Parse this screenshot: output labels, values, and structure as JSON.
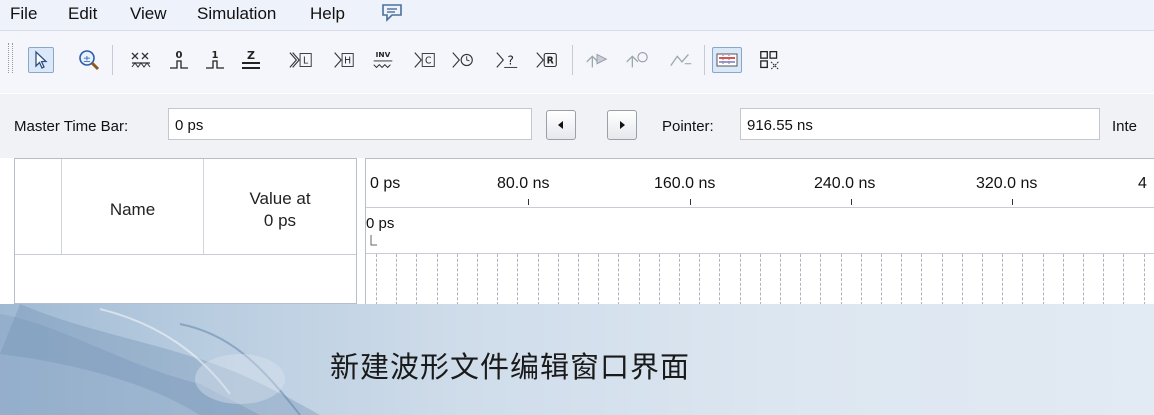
{
  "menu": {
    "file": "File",
    "edit": "Edit",
    "view": "View",
    "simulation": "Simulation",
    "help": "Help",
    "help_icon": "speech-bubble-icon"
  },
  "toolbar": {
    "icons": [
      "selection-tool-icon",
      "zoom-tool-icon",
      "force-unknown-icon",
      "force-low-icon",
      "force-high-icon",
      "force-high-impedance-icon",
      "force-weak-low-icon",
      "force-weak-high-icon",
      "invert-icon",
      "count-value-icon",
      "clock-icon",
      "random-value-icon",
      "arbitrary-value-icon",
      "run-functional-simulation-icon",
      "run-timing-simulation-icon",
      "generate-netlist-icon",
      "snap-to-grid-icon",
      "grid-settings-icon"
    ],
    "labels": {
      "force_low": "0",
      "force_high": "1",
      "high_impedance": "Z",
      "weak_low": "L",
      "weak_high": "H",
      "invert": "INV",
      "count": "C",
      "clock": "⏱",
      "random": "?",
      "arbitrary": "R"
    }
  },
  "master": {
    "master_label": "Master Time Bar:",
    "master_value": "0 ps",
    "pointer_label": "Pointer:",
    "pointer_value": "916.55 ns",
    "interval_label": "Inte"
  },
  "grid": {
    "col_name": "Name",
    "col_value_line1": "Value at",
    "col_value_line2": "0 ps"
  },
  "timeline": {
    "ticks": [
      "0 ps",
      "80.0 ns",
      "160.0 ns",
      "240.0 ns",
      "320.0 ns",
      "4"
    ],
    "cursor_label": "0 ps"
  },
  "caption": "新建波形文件编辑窗口界面"
}
